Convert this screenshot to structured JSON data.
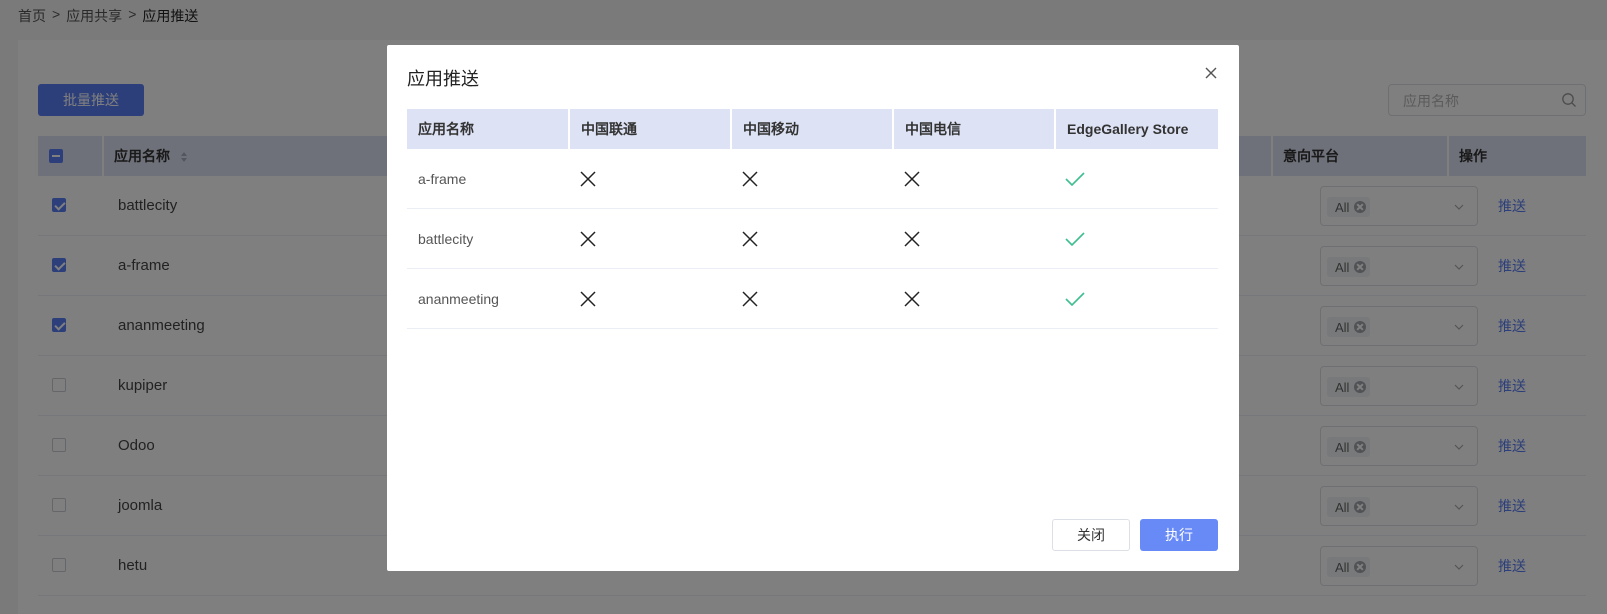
{
  "breadcrumb": {
    "home": "首页",
    "sep": ">",
    "share": "应用共享",
    "current": "应用推送"
  },
  "toolbar": {
    "batch_push": "批量推送",
    "search_placeholder": "应用名称"
  },
  "table": {
    "headers": {
      "name": "应用名称",
      "platform": "意向平台",
      "action": "操作"
    },
    "rows": [
      {
        "name": "battlecity",
        "checked": true,
        "platform_tag": "All",
        "action": "推送"
      },
      {
        "name": "a-frame",
        "checked": true,
        "platform_tag": "All",
        "action": "推送"
      },
      {
        "name": "ananmeeting",
        "checked": true,
        "platform_tag": "All",
        "action": "推送"
      },
      {
        "name": "kupiper",
        "checked": false,
        "platform_tag": "All",
        "action": "推送"
      },
      {
        "name": "Odoo",
        "checked": false,
        "platform_tag": "All",
        "action": "推送"
      },
      {
        "name": "joomla",
        "checked": false,
        "platform_tag": "All",
        "action": "推送"
      },
      {
        "name": "hetu",
        "checked": false,
        "platform_tag": "All",
        "action": "推送"
      }
    ]
  },
  "modal": {
    "title": "应用推送",
    "columns": [
      "应用名称",
      "中国联通",
      "中国移动",
      "中国电信",
      "EdgeGallery Store"
    ],
    "rows": [
      {
        "name": "a-frame",
        "status": [
          "x",
          "x",
          "x",
          "check"
        ]
      },
      {
        "name": "battlecity",
        "status": [
          "x",
          "x",
          "x",
          "check"
        ]
      },
      {
        "name": "ananmeeting",
        "status": [
          "x",
          "x",
          "x",
          "check"
        ]
      }
    ],
    "close_label": "关闭",
    "exec_label": "执行"
  },
  "colors": {
    "accent": "#5b7ff5",
    "check": "#3dbf8f",
    "x": "#222222",
    "header_bg": "#dde2f4"
  }
}
